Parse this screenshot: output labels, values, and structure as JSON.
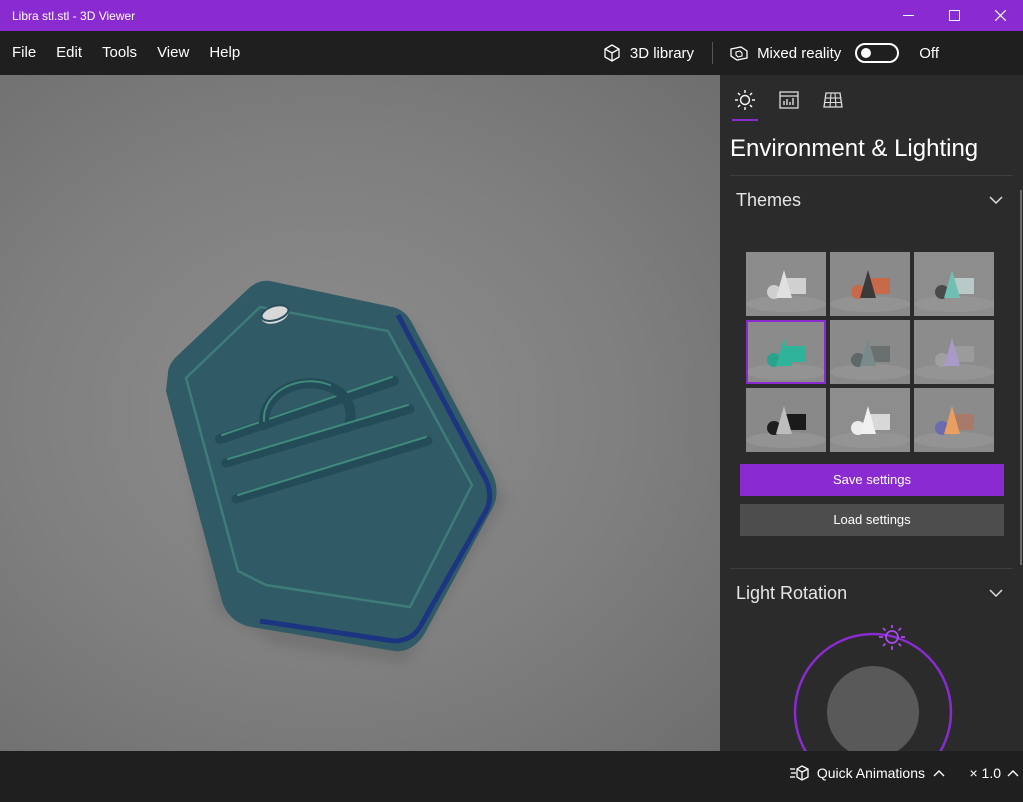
{
  "window": {
    "title": "Libra stl.stl - 3D Viewer"
  },
  "menu": {
    "items": [
      "File",
      "Edit",
      "Tools",
      "View",
      "Help"
    ],
    "library_label": "3D library",
    "mixed_reality_label": "Mixed reality",
    "mixed_reality_state": "Off"
  },
  "panel": {
    "title": "Environment & Lighting",
    "themes": {
      "heading": "Themes",
      "items": [
        {
          "bg": "#8c8c8c",
          "cone": "#e0e0e0",
          "box": "#d0d0d0",
          "sphere": "#cfcfcf"
        },
        {
          "bg": "#8a8a8a",
          "cone": "#3a3a3a",
          "box": "#c86a4a",
          "sphere": "#c86a4a"
        },
        {
          "bg": "#8d8d8d",
          "cone": "#6fbfb2",
          "box": "#b9c9c7",
          "sphere": "#4a4a4a"
        },
        {
          "bg": "#8b8b8b",
          "cone": "#2fb39a",
          "box": "#2fb39a",
          "sphere": "#2aa38c"
        },
        {
          "bg": "#8a8a8a",
          "cone": "#7a8a8a",
          "box": "#6a7070",
          "sphere": "#5f6868"
        },
        {
          "bg": "#8c8c8c",
          "cone": "#a79ac8",
          "box": "#9b9b9b",
          "sphere": "#a0a0a0"
        },
        {
          "bg": "#898989",
          "cone": "#bdbdbd",
          "box": "#1a1a1a",
          "sphere": "#1e1e1e"
        },
        {
          "bg": "#8d8d8d",
          "cone": "#f0f0f0",
          "box": "#d8d8d8",
          "sphere": "#ececec"
        },
        {
          "bg": "#8b8b8b",
          "cone": "#e8a060",
          "box": "#a97a6a",
          "sphere": "#6a6ab0"
        }
      ],
      "selected_index": 3,
      "save_label": "Save settings",
      "load_label": "Load settings"
    },
    "light_rotation": {
      "heading": "Light Rotation"
    }
  },
  "status": {
    "quick_animations": "Quick Animations",
    "speed": "× 1.0"
  },
  "colors": {
    "accent": "#8a2bd1",
    "model": "#2f5a66",
    "model_edge": "#1a2f86"
  }
}
